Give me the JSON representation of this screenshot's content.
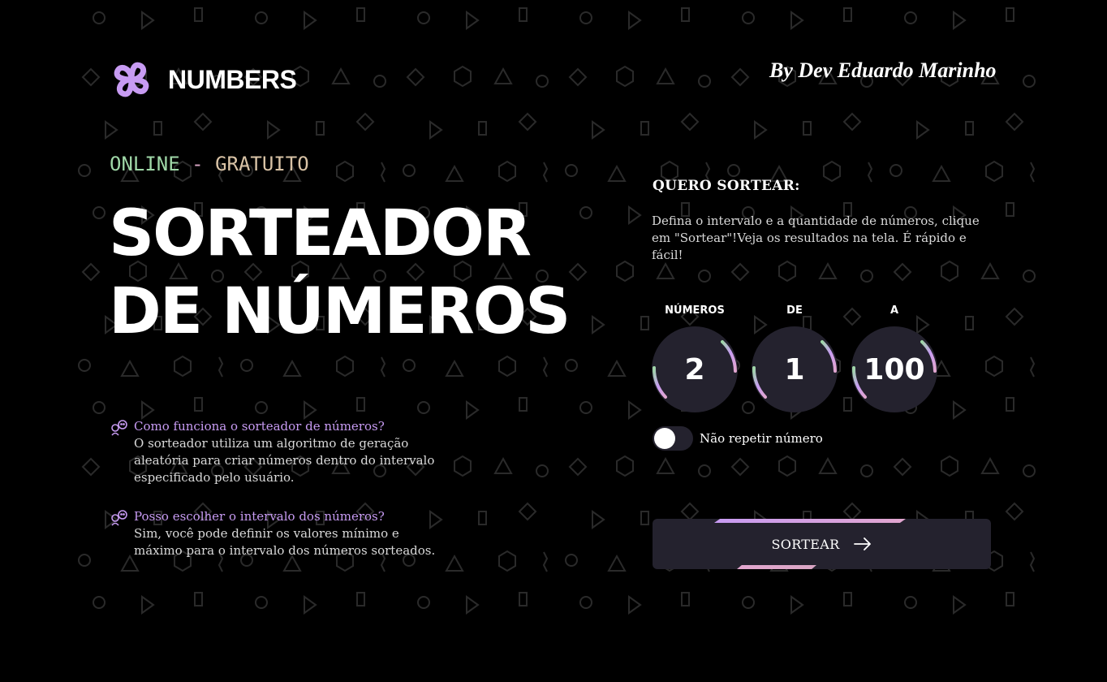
{
  "header": {
    "logo_icon": "four-petal-loop-icon",
    "brand_name": "NUMBERS",
    "author": "By Dev Eduardo Marinho"
  },
  "hero": {
    "tag_online": "ONLINE",
    "tag_separator": " - ",
    "tag_free": "GRATUITO",
    "title_line1": "SORTEADOR",
    "title_line2": "DE NÚMEROS"
  },
  "faq": [
    {
      "icon": "two-speech-faces-icon",
      "question": "Como funciona o sorteador de números?",
      "answer": "O sorteador utiliza um algoritmo de geração aleatória para criar números dentro do intervalo especificado pelo usuário."
    },
    {
      "icon": "two-speech-faces-icon",
      "question": "Posso escolher o intervalo dos números?",
      "answer": "Sim, você pode definir os valores mínimo e máximo para o intervalo dos números sorteados."
    }
  ],
  "panel": {
    "title": "QUERO SORTEAR:",
    "description": "Defina o intervalo e a quantidade de números, clique em \"Sortear\"!Veja os resultados na tela. É rápido e fácil!",
    "fields": [
      {
        "label": "NÚMEROS",
        "value": "2"
      },
      {
        "label": "DE",
        "value": "1"
      },
      {
        "label": "A",
        "value": "100"
      }
    ],
    "toggle_label": "Não repetir número",
    "toggle_on": false,
    "button_label": "SORTEAR",
    "button_icon": "arrow-right-icon"
  },
  "colors": {
    "background": "#000000",
    "accent_purple": "#c79bf2",
    "accent_green": "#9fd7a7",
    "accent_pink": "#d9a6c4",
    "surface": "#24222e"
  }
}
